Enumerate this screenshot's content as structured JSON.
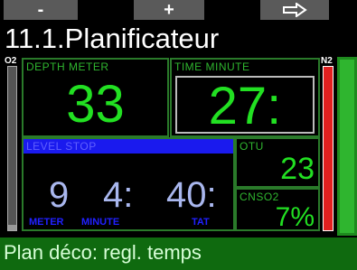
{
  "softkeys": {
    "left": "-",
    "middle": "+",
    "right_icon": "arrow-right-icon"
  },
  "title": "11.1.Planificateur",
  "o2_label": "O2",
  "n2_label": "N2",
  "depth": {
    "label": "DEPTH METER",
    "value": "33"
  },
  "time": {
    "label": "TIME MINUTE",
    "value": "27:"
  },
  "level_stop": {
    "label": "LEVEL STOP",
    "depth_value": "9",
    "minute_value": "4:",
    "tat_value": "40:",
    "depth_unit": "METER",
    "minute_unit": "MINUTE",
    "tat_unit": "TAT"
  },
  "otu": {
    "label": "OTU",
    "value": "23"
  },
  "cnso2": {
    "label": "CNSO2",
    "value": "7%"
  },
  "status_text": "Plan déco: regl. temps",
  "colors": {
    "digit_green": "#22e022",
    "frame_green": "#2a7a2a",
    "level_blue": "#1a1aee",
    "n2_red": "#e02020",
    "status_bg": "#0f6a0f"
  }
}
